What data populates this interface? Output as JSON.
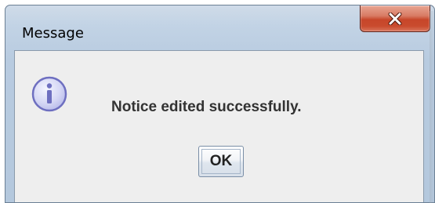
{
  "window": {
    "title": "Message",
    "close_icon": "close-x-icon"
  },
  "dialog": {
    "icon": "information-icon",
    "message": "Notice edited successfully.",
    "ok_label": "OK"
  },
  "colors": {
    "titlebar": "#c2d3e5",
    "client_background": "#eeeeee",
    "close_button": "#c7462a",
    "info_icon_border": "#6e6fc0",
    "info_icon_fill": "#d6d8f5"
  }
}
